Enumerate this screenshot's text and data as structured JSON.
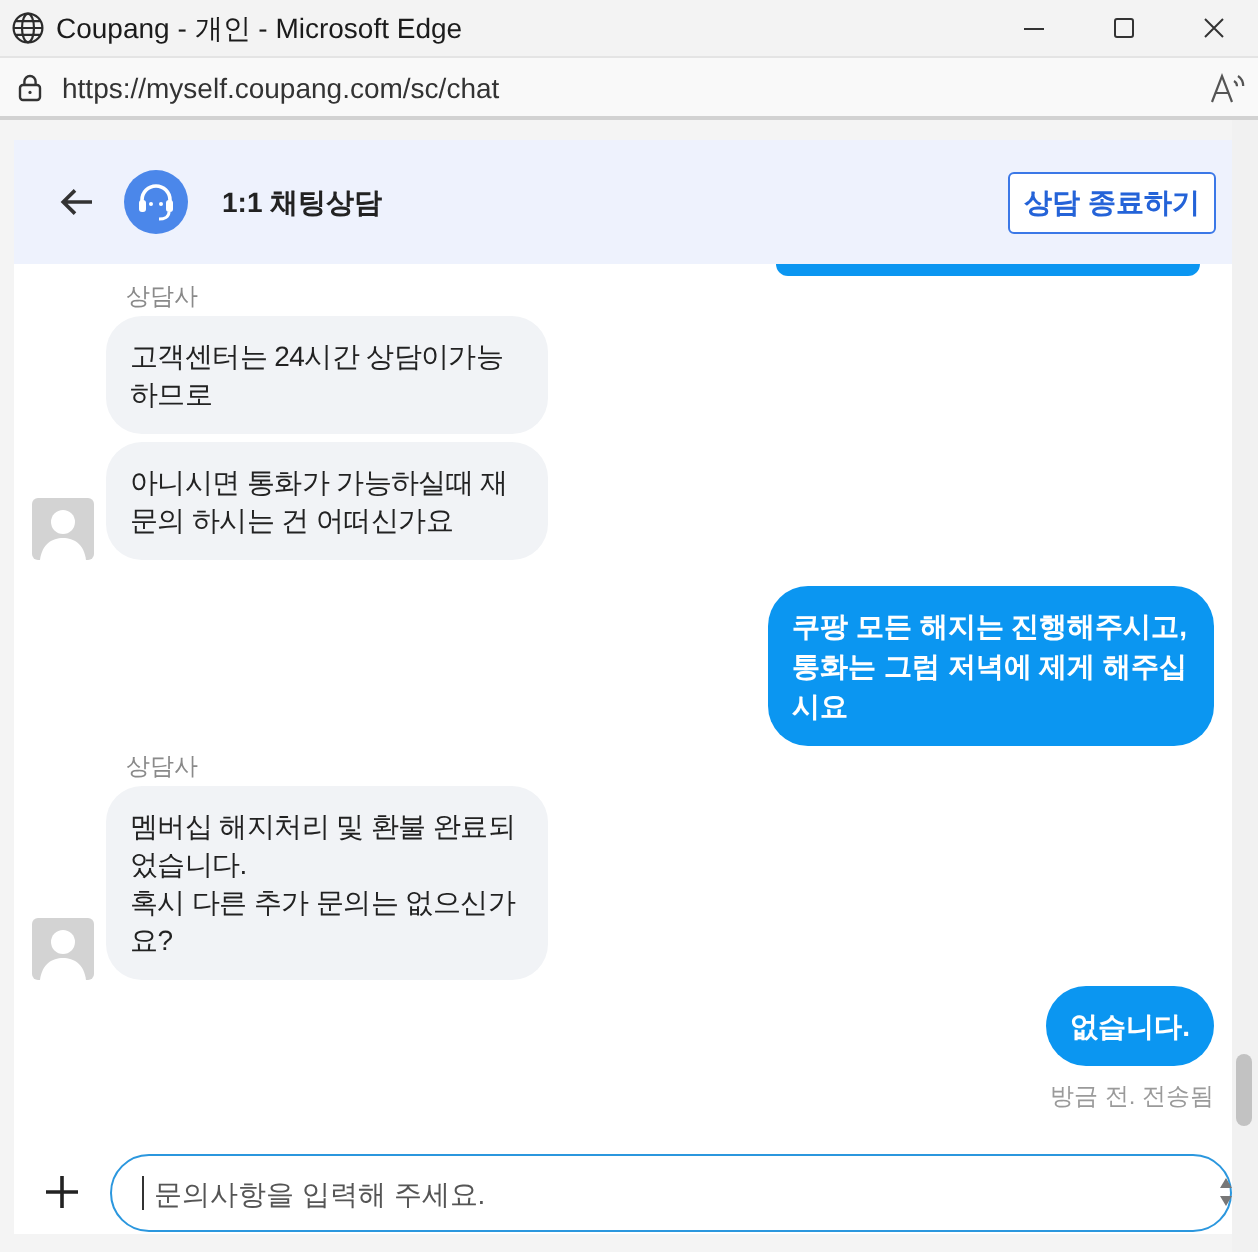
{
  "window": {
    "title": "Coupang - 개인 - Microsoft Edge"
  },
  "address_bar": {
    "url": "https://myself.coupang.com/sc/chat"
  },
  "chat_header": {
    "title": "1:1 채팅상담",
    "end_button": "상담 종료하기"
  },
  "messages": [
    {
      "kind": "user",
      "clipped": true
    },
    {
      "kind": "agent",
      "clipped": false,
      "name": "상담사",
      "bubbles": [
        "고객센터는 24시간 상담이가능하므로",
        "아니시면 통화가 가능하실때 재문의 하시는 건 어떠신가요"
      ]
    },
    {
      "kind": "user",
      "clipped": false,
      "bubbles": [
        "쿠팡 모든 해지는 진행해주시고, 통화는 그럼 저녁에 제게 해주십시요"
      ]
    },
    {
      "kind": "agent",
      "clipped": false,
      "name": "상담사",
      "bubbles": [
        "멤버십 해지처리 및 환불 완료되었습니다.\n혹시 다른 추가 문의는 없으신가요?"
      ]
    },
    {
      "kind": "user",
      "clipped": false,
      "bubbles": [
        "없습니다."
      ],
      "status": "방금 전. 전송됨"
    }
  ],
  "composer": {
    "placeholder": "문의사항을 입력해 주세요."
  }
}
